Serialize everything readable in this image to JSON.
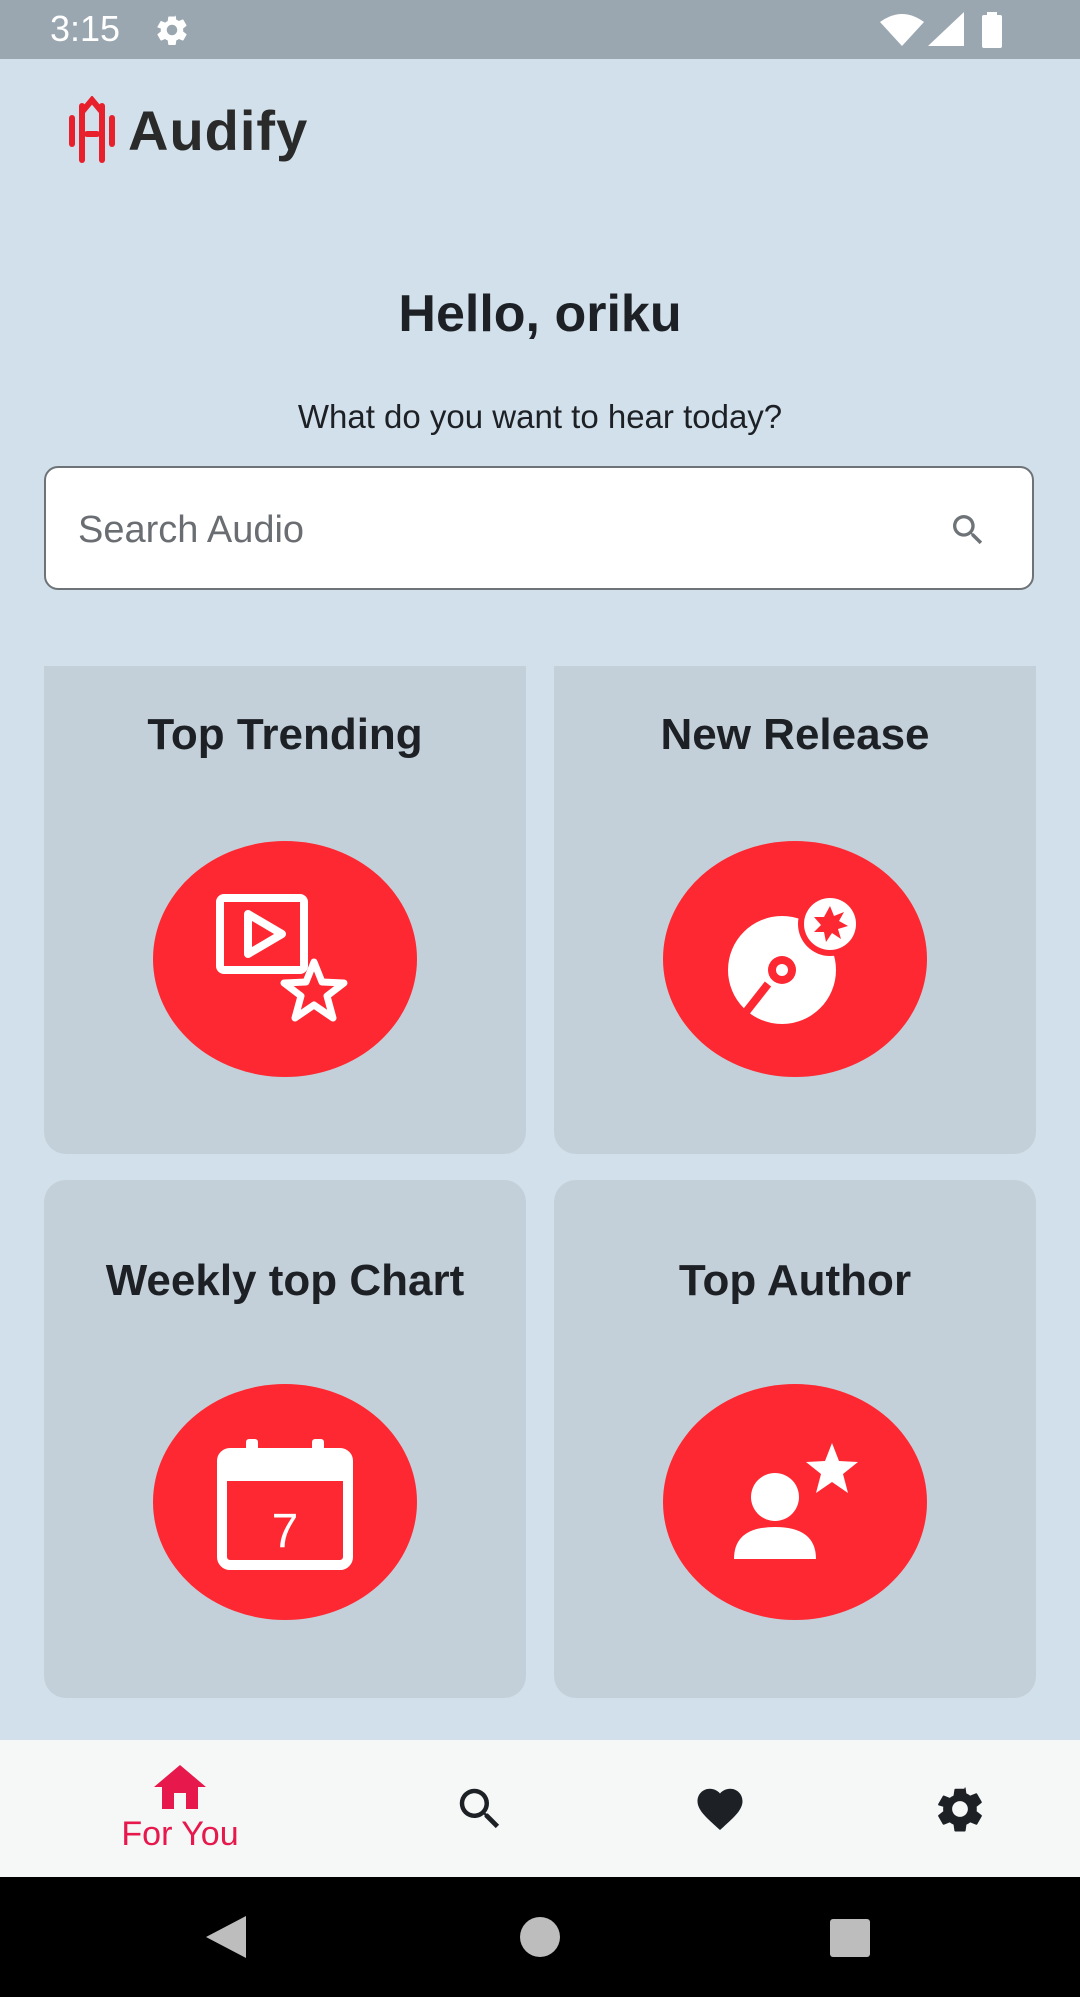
{
  "status_bar": {
    "time": "3:15"
  },
  "app": {
    "name": "Audify"
  },
  "greeting": {
    "title": "Hello, oriku",
    "subtitle": "What do you want to hear today?"
  },
  "search": {
    "placeholder": "Search Audio",
    "value": ""
  },
  "categories": [
    {
      "title": "Top Trending",
      "icon": "video-star-icon"
    },
    {
      "title": "New Release",
      "icon": "disc-new-icon"
    },
    {
      "title": "Weekly top Chart",
      "icon": "calendar-7-icon",
      "calendar_day": "7"
    },
    {
      "title": "Top Author",
      "icon": "person-star-icon"
    }
  ],
  "bottom_nav": {
    "items": [
      {
        "label": "For You",
        "icon": "home-icon",
        "active": true
      },
      {
        "label": "",
        "icon": "search-icon",
        "active": false
      },
      {
        "label": "",
        "icon": "heart-icon",
        "active": false
      },
      {
        "label": "",
        "icon": "gear-icon",
        "active": false
      }
    ]
  },
  "colors": {
    "background": "#d1e0ea",
    "card": "#c4d0d9",
    "accent_red": "#fd2832",
    "nav_active": "#e7184c",
    "status_bar": "#9aa7b0"
  }
}
